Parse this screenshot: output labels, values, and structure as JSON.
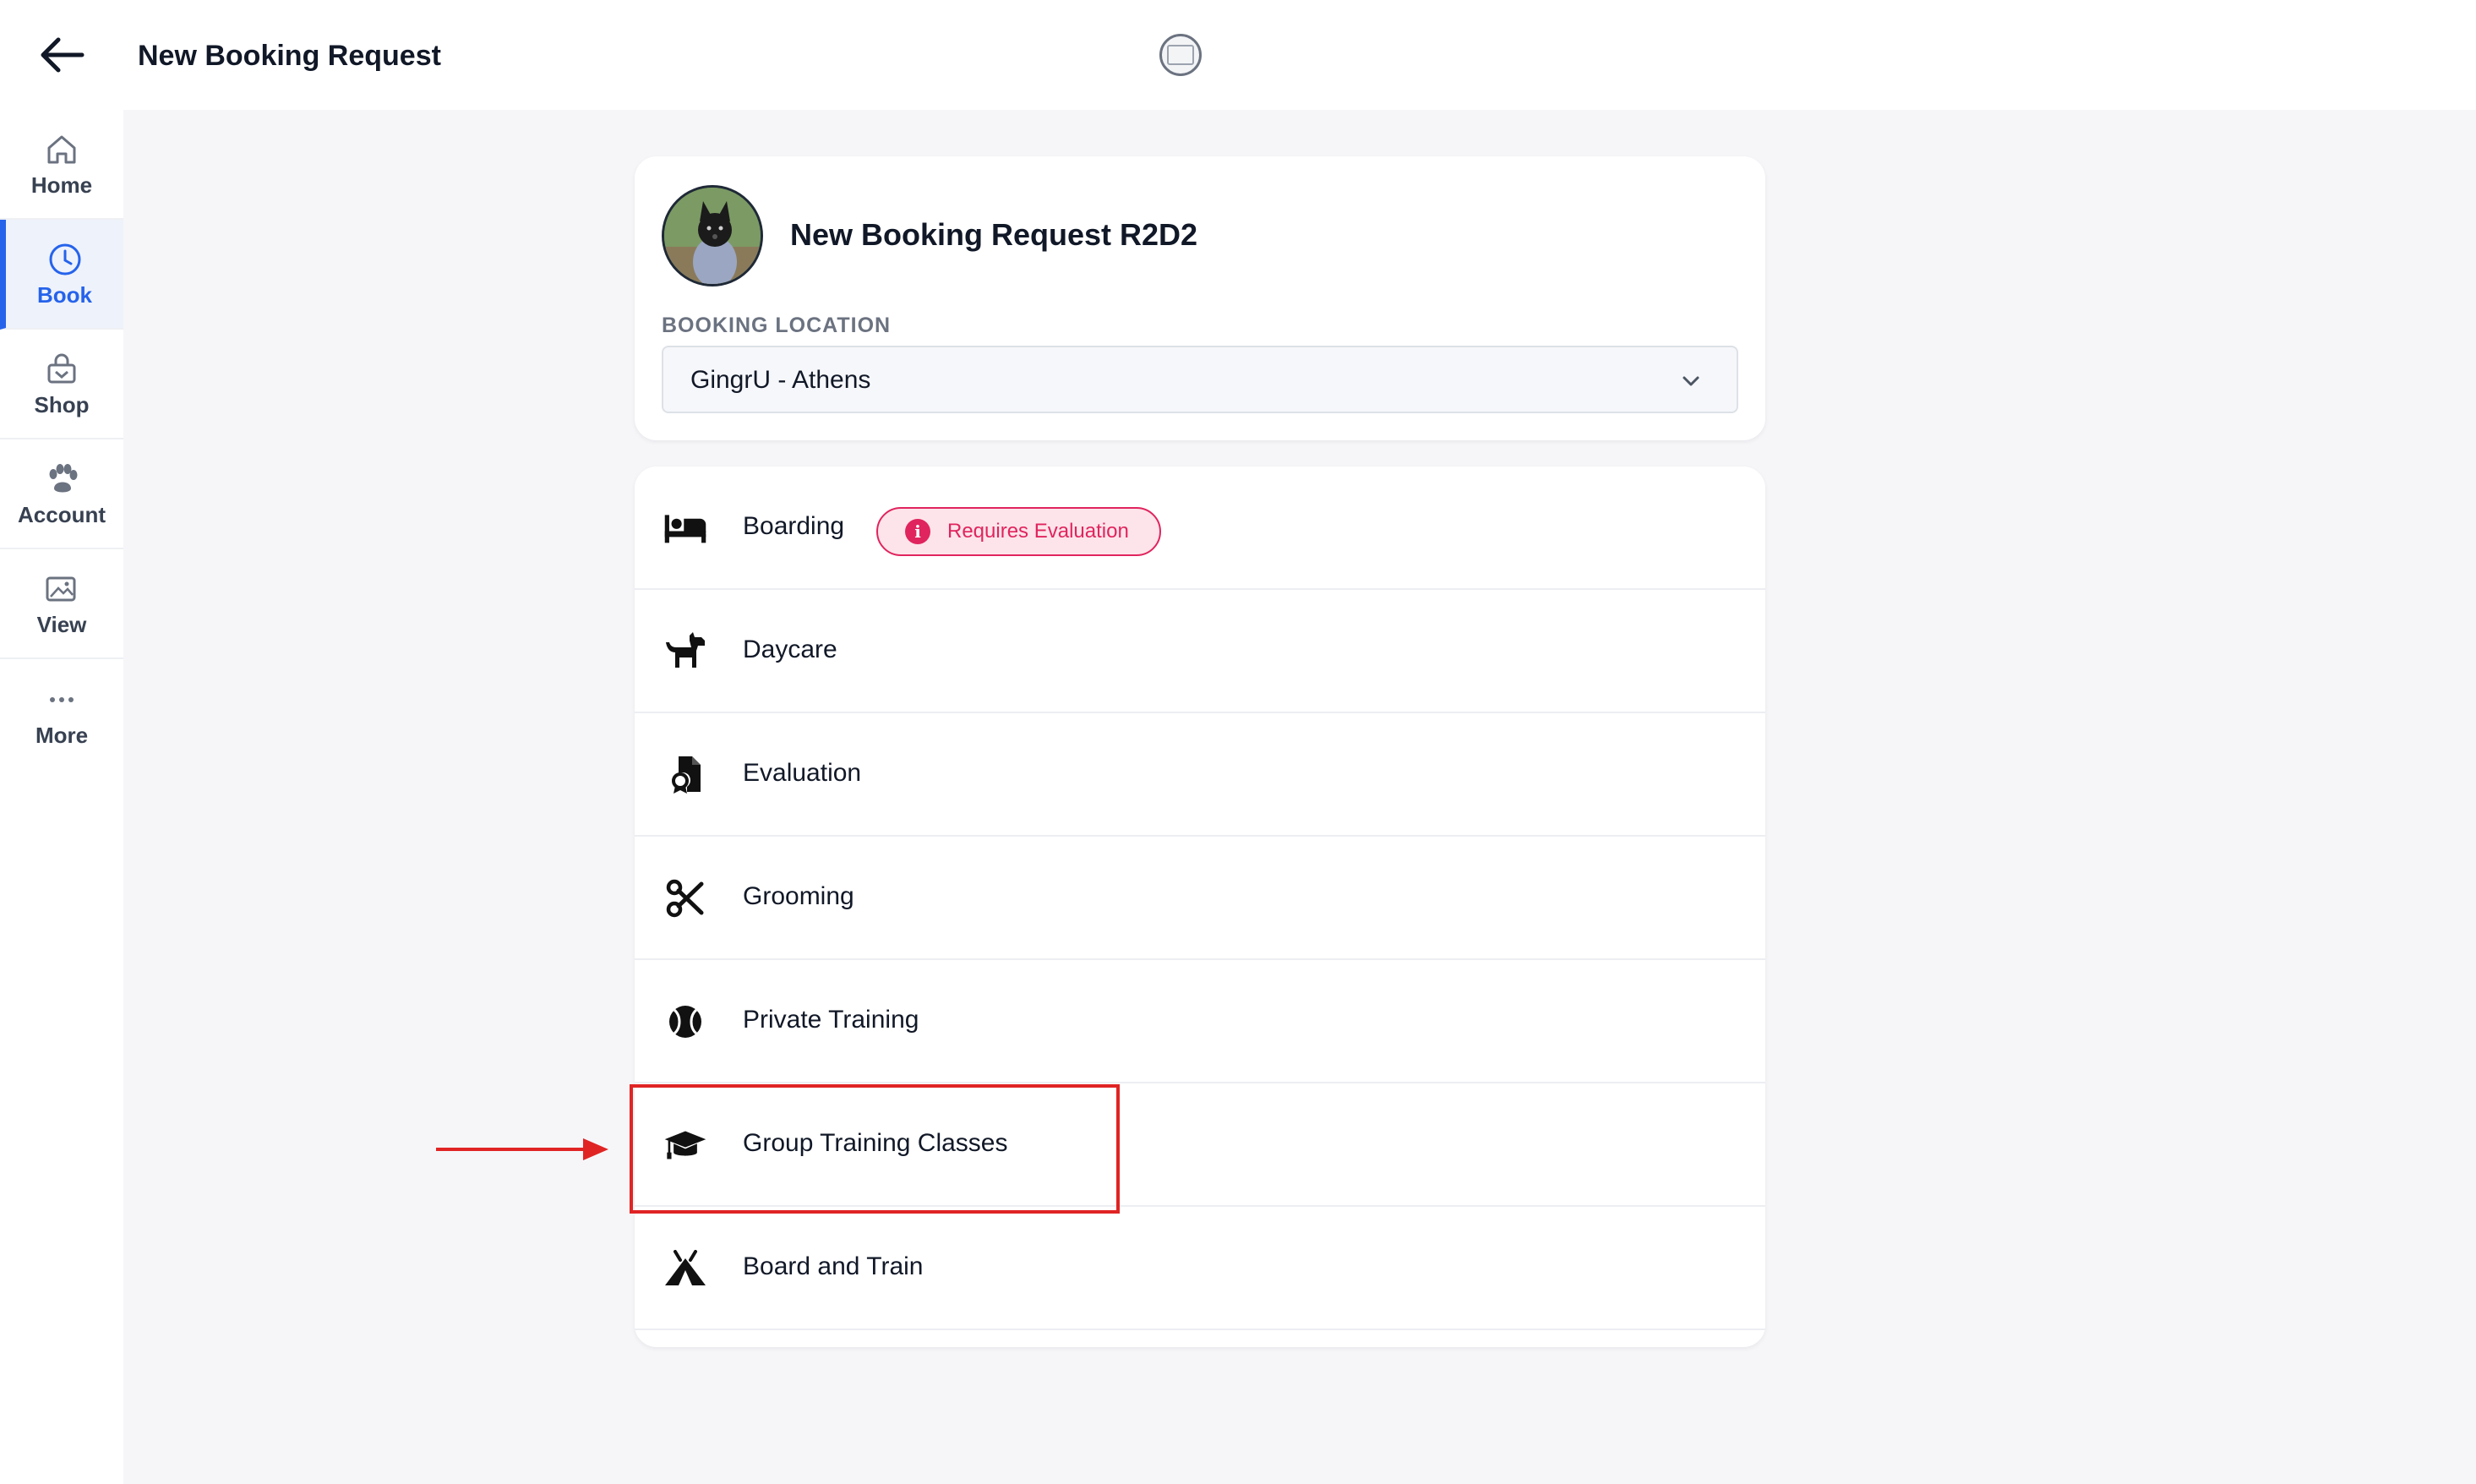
{
  "header": {
    "title": "New Booking Request",
    "back_icon": "arrow-left-icon",
    "logo_icon": "brand-logo-icon"
  },
  "sidebar": {
    "items": [
      {
        "label": "Home",
        "icon": "home-icon",
        "active": false
      },
      {
        "label": "Book",
        "icon": "clock-icon",
        "active": true
      },
      {
        "label": "Shop",
        "icon": "shopping-bag-icon",
        "active": false
      },
      {
        "label": "Account",
        "icon": "paw-icon",
        "active": false
      },
      {
        "label": "View",
        "icon": "image-gallery-icon",
        "active": false
      },
      {
        "label": "More",
        "icon": "ellipsis-icon",
        "active": false
      }
    ]
  },
  "booking": {
    "title": "New Booking Request R2D2",
    "location_label": "BOOKING LOCATION",
    "location_value": "GingrU - Athens"
  },
  "services": [
    {
      "label": "Boarding",
      "icon": "bed-icon",
      "badge": "Requires Evaluation"
    },
    {
      "label": "Daycare",
      "icon": "dog-icon"
    },
    {
      "label": "Evaluation",
      "icon": "file-certificate-icon"
    },
    {
      "label": "Grooming",
      "icon": "scissors-icon"
    },
    {
      "label": "Private Training",
      "icon": "tennis-ball-icon"
    },
    {
      "label": "Group Training Classes",
      "icon": "graduation-cap-icon",
      "highlighted": true
    },
    {
      "label": "Board and Train",
      "icon": "tent-icon"
    }
  ],
  "colors": {
    "accent": "#2563eb",
    "badge": "#e0245e",
    "badge_bg": "#fde4ea",
    "annotation": "#e02424",
    "background": "#f6f6f9"
  }
}
